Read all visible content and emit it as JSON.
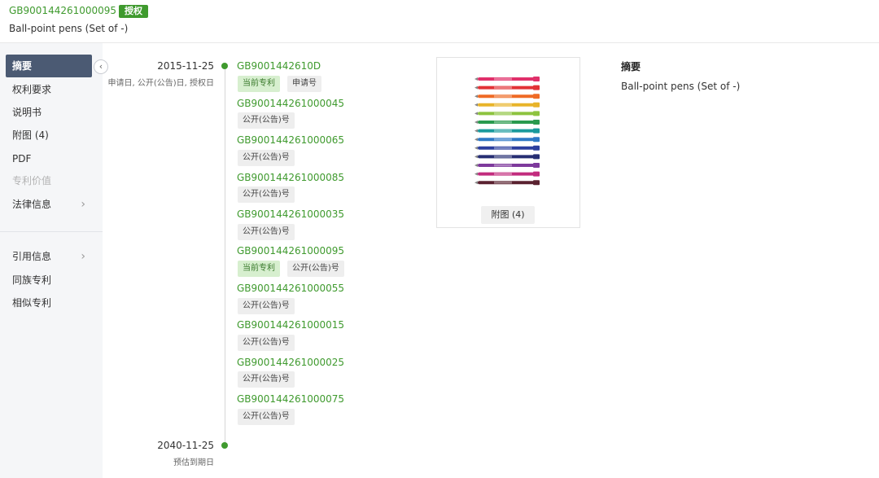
{
  "header": {
    "patent_number": "GB900144261000095",
    "status_badge": "授权",
    "title": "Ball-point pens (Set of -)"
  },
  "sidebar": {
    "items": [
      {
        "label": "摘要"
      },
      {
        "label": "权利要求"
      },
      {
        "label": "说明书"
      },
      {
        "label": "附图 (4)"
      },
      {
        "label": "PDF"
      },
      {
        "label": "专利价值"
      },
      {
        "label": "法律信息"
      },
      {
        "label": "引用信息"
      },
      {
        "label": "同族专利"
      },
      {
        "label": "相似专利"
      }
    ],
    "collapse_icon": "chevron-left-icon"
  },
  "timeline": {
    "start_date": "2015-11-25",
    "start_desc": "申请日, 公开(公告)日, 授权日",
    "end_date": "2040-11-25",
    "end_desc": "预估到期日",
    "entries": [
      {
        "number": "GB9001442610D",
        "tags": [
          "当前专利",
          "申请号"
        ]
      },
      {
        "number": "GB900144261000045",
        "tags": [
          "公开(公告)号"
        ]
      },
      {
        "number": "GB900144261000065",
        "tags": [
          "公开(公告)号"
        ]
      },
      {
        "number": "GB900144261000085",
        "tags": [
          "公开(公告)号"
        ]
      },
      {
        "number": "GB900144261000035",
        "tags": [
          "公开(公告)号"
        ]
      },
      {
        "number": "GB900144261000095",
        "tags": [
          "当前专利",
          "公开(公告)号"
        ]
      },
      {
        "number": "GB900144261000055",
        "tags": [
          "公开(公告)号"
        ]
      },
      {
        "number": "GB900144261000015",
        "tags": [
          "公开(公告)号"
        ]
      },
      {
        "number": "GB900144261000025",
        "tags": [
          "公开(公告)号"
        ]
      },
      {
        "number": "GB900144261000075",
        "tags": [
          "公开(公告)号"
        ]
      }
    ]
  },
  "figure": {
    "label": "附图 (4)",
    "pen_colors": [
      "#e0306a",
      "#e23236",
      "#ef6a25",
      "#e8b42a",
      "#8dc33f",
      "#2a9a4e",
      "#1a9a9c",
      "#2f79c6",
      "#2c3f9e",
      "#262e73",
      "#7e3a9c",
      "#c22c7e",
      "#5a2230"
    ]
  },
  "abstract": {
    "title": "摘要",
    "text": "Ball-point pens (Set of -)"
  },
  "colors": {
    "accent_green": "#3f9a2e",
    "active_nav": "#4b5a73"
  }
}
